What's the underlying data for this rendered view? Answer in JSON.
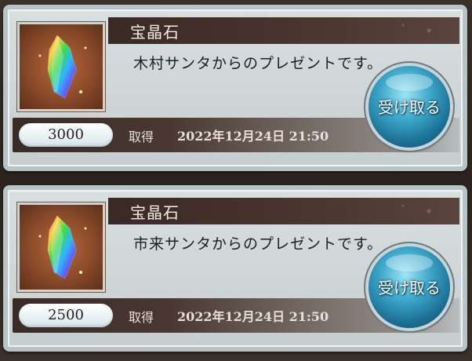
{
  "gifts": [
    {
      "item_name": "宝晶石",
      "message": "木村サンタからのプレゼントです。",
      "amount": "3000",
      "acquired_label": "取得",
      "date": "2022年12月24日 21:50",
      "button_label": "受け取る",
      "icon": "crystal-icon"
    },
    {
      "item_name": "宝晶石",
      "message": "市来サンタからのプレゼントです。",
      "amount": "2500",
      "acquired_label": "取得",
      "date": "2022年12月24日 21:50",
      "button_label": "受け取る",
      "icon": "crystal-icon"
    }
  ],
  "colors": {
    "background": "#2f2621",
    "card": "#cfd7d8",
    "button": "#2f8fb8"
  }
}
